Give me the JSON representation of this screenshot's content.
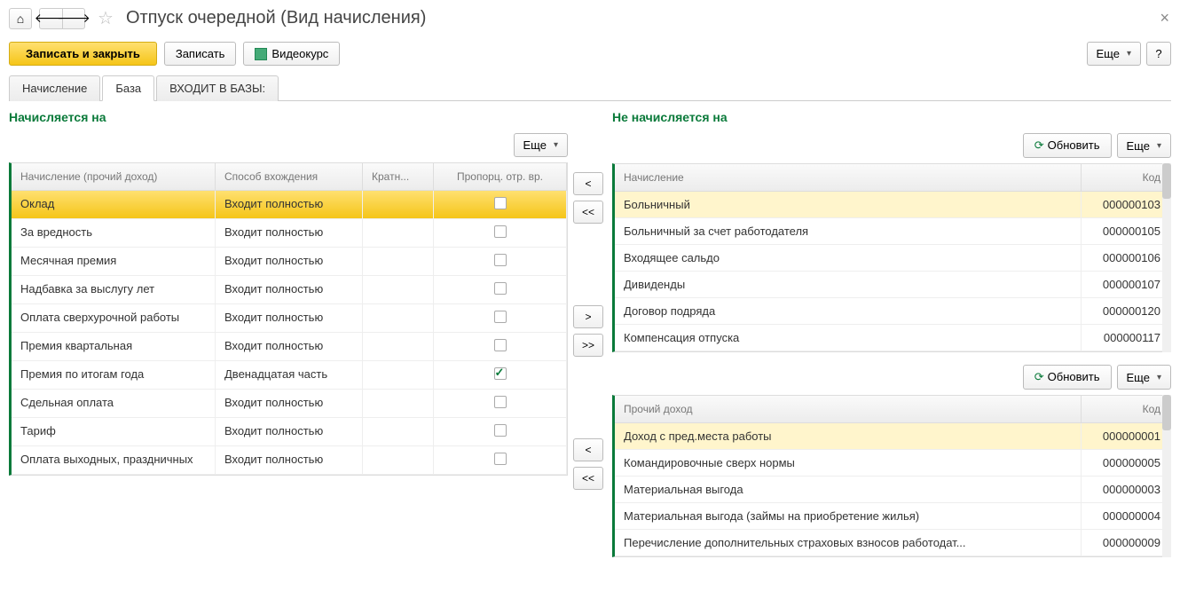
{
  "header": {
    "title": "Отпуск очередной (Вид начисления)"
  },
  "toolbar": {
    "save_close": "Записать и закрыть",
    "save": "Записать",
    "video": "Видеокурс",
    "more": "Еще",
    "help": "?"
  },
  "tabs": {
    "t0": "Начисление",
    "t1": "База",
    "t2": "ВХОДИТ В БАЗЫ:"
  },
  "left": {
    "title": "Начисляется на",
    "more": "Еще",
    "cols": {
      "name": "Начисление (прочий доход)",
      "way": "Способ вхождения",
      "krat": "Кратн...",
      "prop": "Пропорц. отр. вр."
    },
    "rows": [
      {
        "name": "Оклад",
        "way": "Входит полностью",
        "chk": false,
        "sel": true
      },
      {
        "name": "За вредность",
        "way": "Входит полностью",
        "chk": false
      },
      {
        "name": "Месячная премия",
        "way": "Входит полностью",
        "chk": false
      },
      {
        "name": "Надбавка за выслугу лет",
        "way": "Входит полностью",
        "chk": false
      },
      {
        "name": "Оплата сверхурочной работы",
        "way": "Входит полностью",
        "chk": false
      },
      {
        "name": "Премия квартальная",
        "way": "Входит полностью",
        "chk": false
      },
      {
        "name": "Премия по итогам года",
        "way": "Двенадцатая часть",
        "chk": true
      },
      {
        "name": "Сдельная оплата",
        "way": "Входит полностью",
        "chk": false
      },
      {
        "name": "Тариф",
        "way": "Входит полностью",
        "chk": false
      },
      {
        "name": "Оплата выходных, праздничных",
        "way": "Входит полностью",
        "chk": false
      }
    ]
  },
  "right_top": {
    "title": "Не начисляется на",
    "refresh": "Обновить",
    "more": "Еще",
    "cols": {
      "name": "Начисление",
      "code": "Код"
    },
    "rows": [
      {
        "name": "Больничный",
        "code": "000000103",
        "hl": true
      },
      {
        "name": "Больничный за счет работодателя",
        "code": "000000105"
      },
      {
        "name": "Входящее сальдо",
        "code": "000000106"
      },
      {
        "name": "Дивиденды",
        "code": "000000107"
      },
      {
        "name": "Договор подряда",
        "code": "000000120"
      },
      {
        "name": "Компенсация отпуска",
        "code": "000000117"
      }
    ]
  },
  "right_bottom": {
    "refresh": "Обновить",
    "more": "Еще",
    "cols": {
      "name": "Прочий доход",
      "code": "Код"
    },
    "rows": [
      {
        "name": "Доход с пред.места работы",
        "code": "000000001",
        "hl": true
      },
      {
        "name": "Командировочные сверх нормы",
        "code": "000000005"
      },
      {
        "name": "Материальная выгода",
        "code": "000000003"
      },
      {
        "name": "Материальная выгода (займы на приобретение жилья)",
        "code": "000000004"
      },
      {
        "name": "Перечисление дополнительных страховых взносов работодат...",
        "code": "000000009"
      }
    ]
  },
  "mid": {
    "lt": "<",
    "ltlt": "<<",
    "gt": ">",
    "gtgt": ">>"
  }
}
